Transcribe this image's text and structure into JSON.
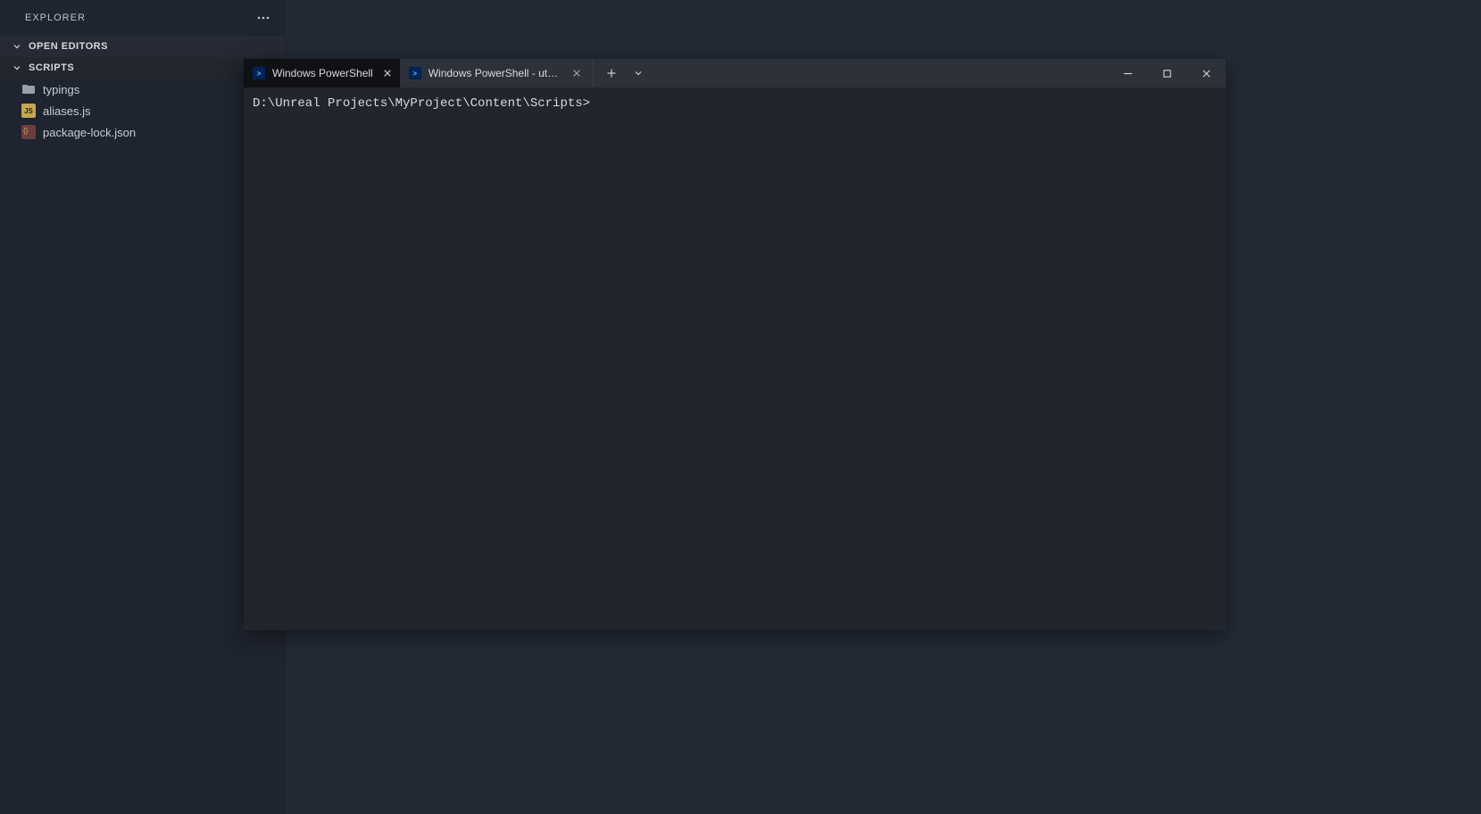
{
  "sidebar": {
    "title": "EXPLORER",
    "sections": [
      {
        "label": "OPEN EDITORS"
      },
      {
        "label": "SCRIPTS"
      }
    ],
    "files": [
      {
        "kind": "folder",
        "name": "typings"
      },
      {
        "kind": "js",
        "name": "aliases.js"
      },
      {
        "kind": "json",
        "name": "package-lock.json"
      }
    ]
  },
  "terminal": {
    "tabs": [
      {
        "label": "Windows PowerShell",
        "active": true
      },
      {
        "label": "Windows PowerShell - uts  watc",
        "active": false
      }
    ],
    "prompt": "D:\\Unreal Projects\\MyProject\\Content\\Scripts>"
  }
}
